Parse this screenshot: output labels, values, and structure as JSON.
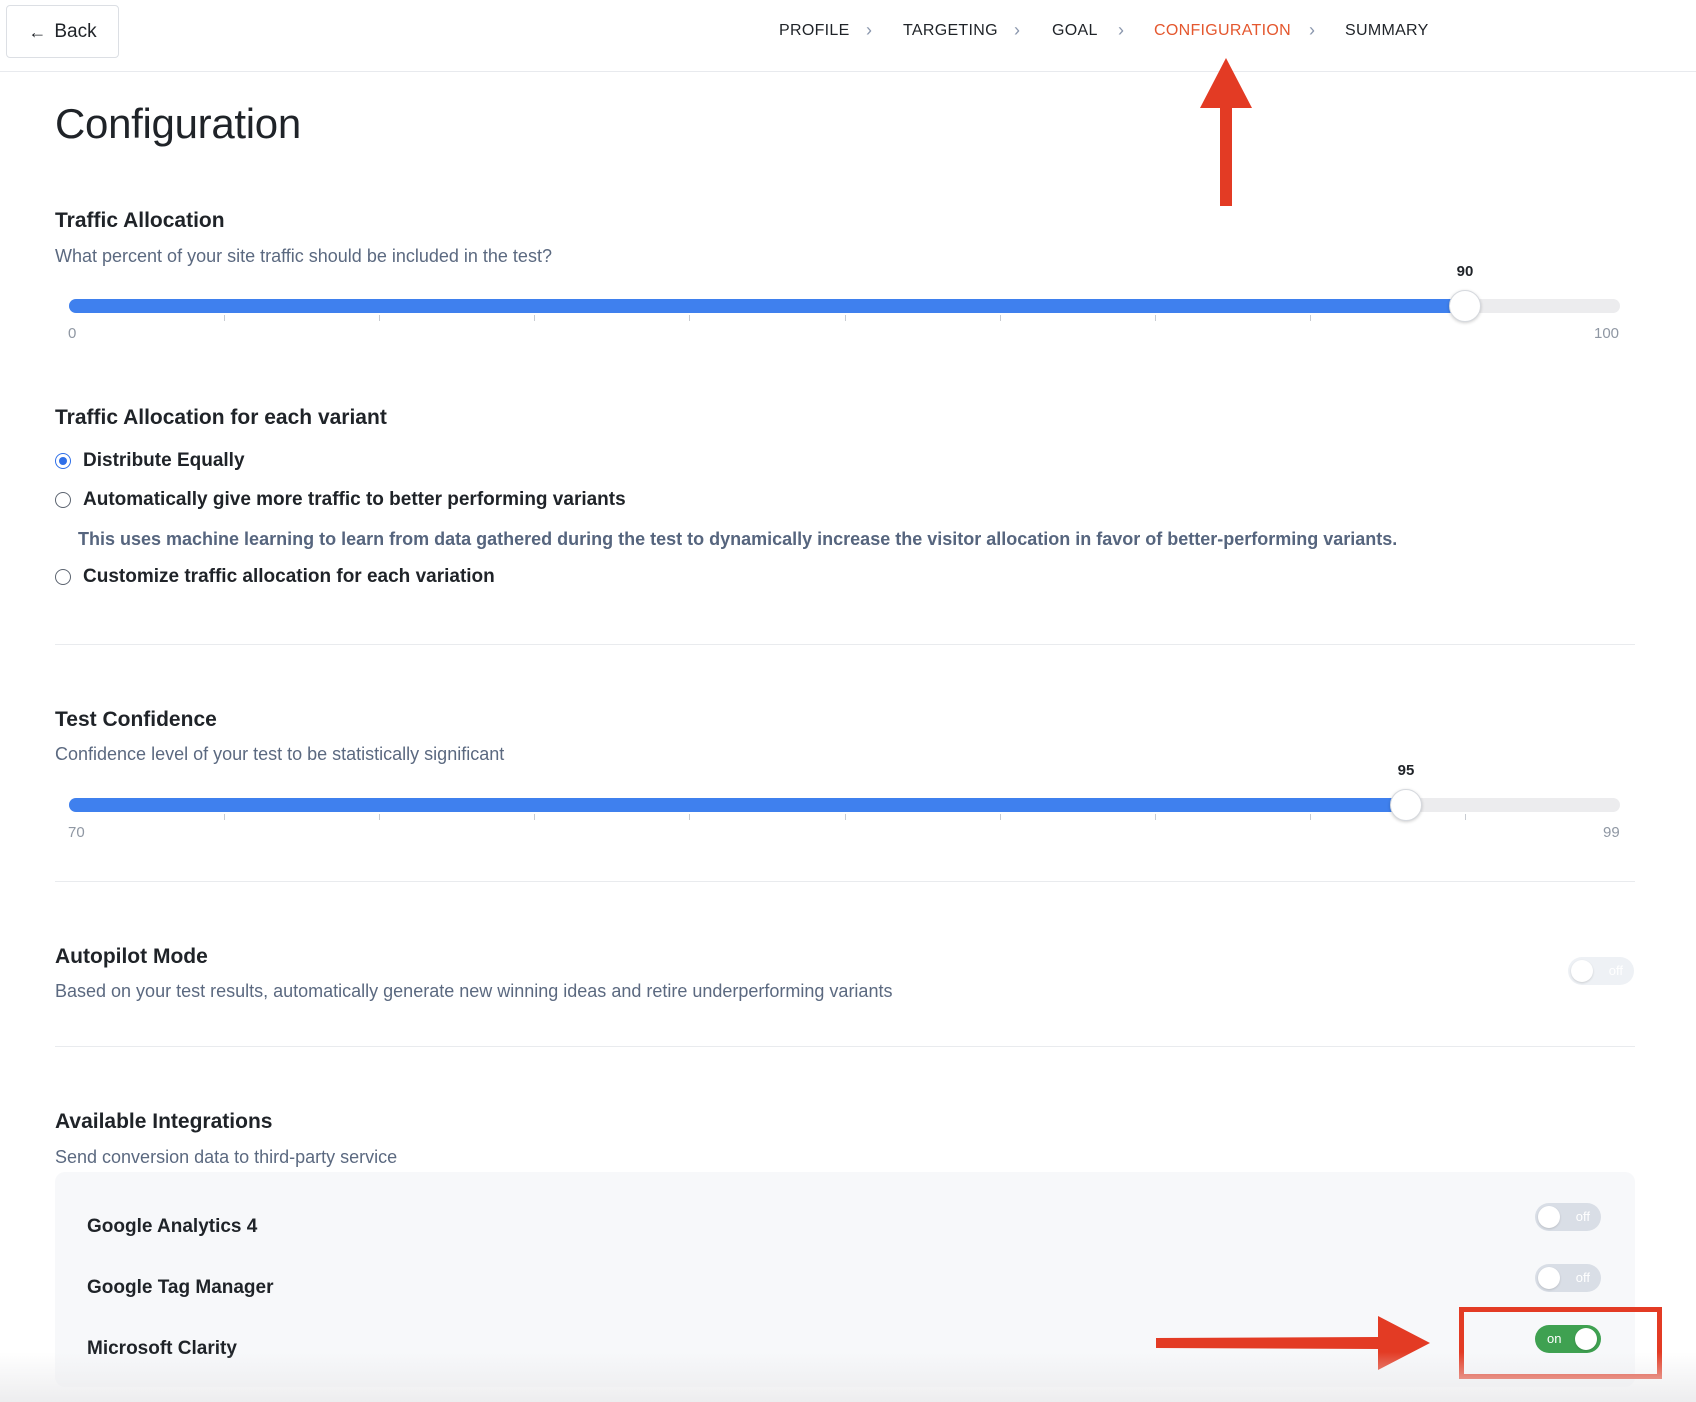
{
  "header": {
    "back_label": "Back",
    "steps": [
      {
        "label": "PROFILE",
        "active": false
      },
      {
        "label": "TARGETING",
        "active": false
      },
      {
        "label": "GOAL",
        "active": false
      },
      {
        "label": "CONFIGURATION",
        "active": true
      },
      {
        "label": "SUMMARY",
        "active": false
      }
    ]
  },
  "page": {
    "title": "Configuration"
  },
  "traffic_allocation": {
    "title": "Traffic Allocation",
    "description": "What percent of your site traffic should be included in the test?",
    "slider": {
      "min": 0,
      "max": 100,
      "value": 90,
      "min_label": "0",
      "max_label": "100",
      "value_label": "90"
    }
  },
  "variant_allocation": {
    "title": "Traffic Allocation for each variant",
    "options": [
      {
        "label": "Distribute Equally",
        "checked": true
      },
      {
        "label": "Automatically give more traffic to better performing variants",
        "checked": false
      },
      {
        "label": "Customize traffic allocation for each variation",
        "checked": false
      }
    ],
    "ml_note": "This uses machine learning to learn from data gathered during the test to dynamically increase the visitor allocation in favor of better-performing variants."
  },
  "test_confidence": {
    "title": "Test Confidence",
    "description": "Confidence level of your test to be statistically significant",
    "slider": {
      "min": 70,
      "max": 99,
      "value": 95,
      "min_label": "70",
      "max_label": "99",
      "value_label": "95"
    }
  },
  "autopilot": {
    "title": "Autopilot Mode",
    "description": "Based on your test results, automatically generate new winning ideas and retire underperforming variants",
    "toggle": {
      "state": "off",
      "label": "off"
    }
  },
  "integrations": {
    "title": "Available Integrations",
    "description": "Send conversion data to third-party service",
    "items": [
      {
        "name": "Google Analytics 4",
        "state": "off",
        "label": "off"
      },
      {
        "name": "Google Tag Manager",
        "state": "off",
        "label": "off"
      },
      {
        "name": "Microsoft Clarity",
        "state": "on",
        "label": "on"
      }
    ]
  },
  "colors": {
    "accent": "#3f80ee",
    "active_step": "#e4572e",
    "toggle_on": "#3fa151",
    "annotation": "#e33b24"
  }
}
